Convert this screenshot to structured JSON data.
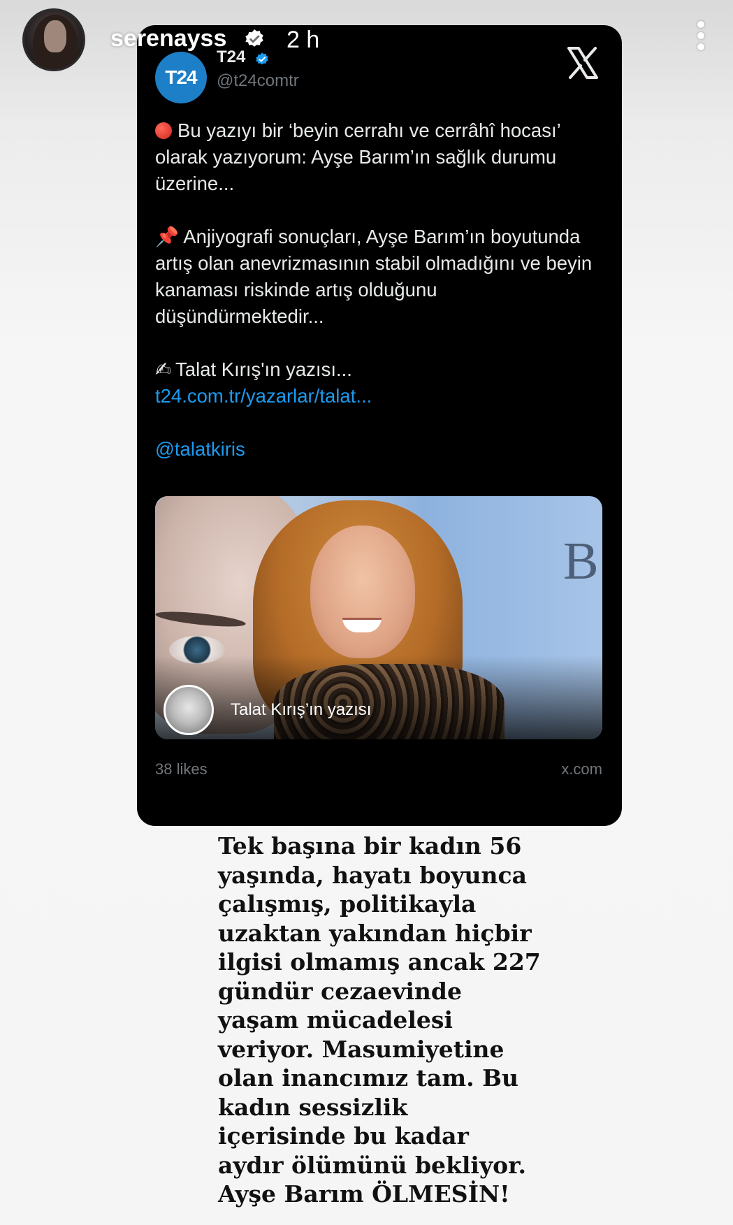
{
  "story": {
    "username": "serenayss",
    "time": "2 h"
  },
  "tweet": {
    "account_name": "T24",
    "logo_text": "T24",
    "handle": "@t24comtr",
    "paragraph1": "Bu yazıyı bir ‘beyin cerrahı ve cerrâhî hocası’ olarak yazıyorum: Ayşe Barım’ın sağlık durumu üzerine...",
    "paragraph2": "Anjiyografi sonuçları, Ayşe Barım’ın boyutunda artış olan anevrizmasının stabil olmadığını ve beyin kanaması riskinde artış olduğunu düşündürmektedir...",
    "paragraph3": "Talat Kırış'ın yazısı...",
    "link": "t24.com.tr/yazarlar/talat...",
    "mention": "@talatkiris",
    "preview_caption": "Talat Kırış’ın yazısı",
    "preview_letter": "B",
    "likes": "38 likes",
    "source": "x.com"
  },
  "caption_lines": [
    "Tek başına bir kadın 56",
    "yaşında,  hayatı boyunca",
    "çalışmış, politikayla",
    "uzaktan yakından hiçbir",
    "ilgisi olmamış ancak 227",
    "gündür cezaevinde",
    "yaşam mücadelesi",
    "veriyor. Masumiyetine",
    "olan inancımız tam. Bu",
    "kadın sessizlik",
    "içerisinde bu kadar",
    "aydır ölümünü bekliyor.",
    "Ayşe Barım ÖLMESİN!"
  ],
  "colors": {
    "card_bg": "#000000",
    "link": "#1d9bf0",
    "muted": "#71767b",
    "t24_blue": "#1d7fc7"
  },
  "icons": [
    "verified-icon",
    "more-icon",
    "x-logo-icon",
    "red-circle-icon",
    "pushpin-icon",
    "writing-hand-icon"
  ]
}
